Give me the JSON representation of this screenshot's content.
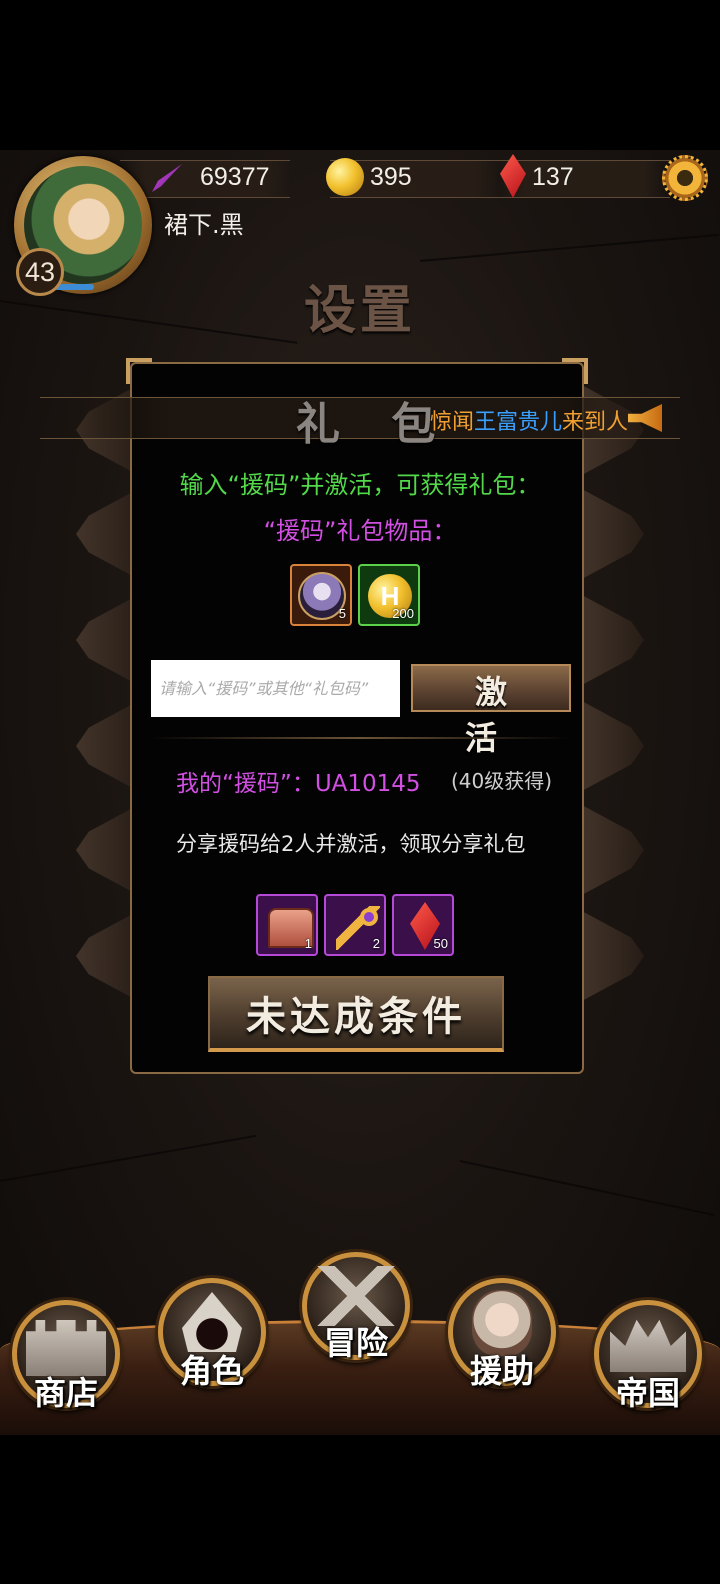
{
  "header": {
    "level": "43",
    "player_name": "裙下.黑",
    "resources": {
      "stamina": "69377",
      "coins": "395",
      "gems": "137"
    },
    "icons": [
      "feather-icon",
      "coin-icon",
      "red-gem-icon",
      "gear-icon"
    ]
  },
  "page_title": "设置",
  "gift_panel": {
    "title": "礼 包",
    "ticker": {
      "prefix": "惊闻",
      "name": "王富贵儿",
      "suffix": "来到人"
    },
    "instruction": "输入“援码”并激活，可获得礼包：",
    "items_label": "“援码”礼包物品：",
    "gift_items": [
      {
        "icon": "character-portrait-icon",
        "count": "5"
      },
      {
        "icon": "coin-icon",
        "coin_glyph": "H",
        "count": "200"
      }
    ],
    "code_input": {
      "value": "",
      "placeholder": "请输入“援码”或其他“礼包码”"
    },
    "activate_label": "激 活",
    "my_code_label": "我的“援码”：UA10145",
    "my_code_note": "(40级获得)",
    "share_text": "分享援码给2人并激活，领取分享礼包",
    "share_items": [
      {
        "icon": "chest-icon",
        "count": "1"
      },
      {
        "icon": "key-icon",
        "count": "2"
      },
      {
        "icon": "red-gem-icon",
        "count": "50"
      }
    ],
    "condition_button": "未达成条件"
  },
  "nav": [
    {
      "label": "商店",
      "icon": "castle-icon"
    },
    {
      "label": "角色",
      "icon": "hood-icon"
    },
    {
      "label": "冒险",
      "icon": "crossed-swords-icon"
    },
    {
      "label": "援助",
      "icon": "girl-portrait-icon"
    },
    {
      "label": "帝国",
      "icon": "crown-icon"
    }
  ],
  "colors": {
    "instruction_green": "#52d94a",
    "code_purple": "#d24fe3",
    "ticker_orange": "#f0a030",
    "ticker_blue": "#3aa0ff",
    "gold_border": "#c9913e"
  }
}
